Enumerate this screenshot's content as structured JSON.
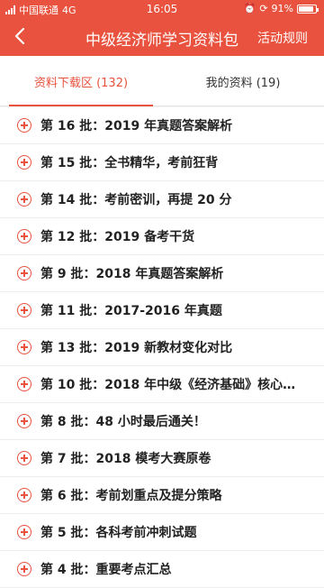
{
  "status": {
    "carrier": "中国联通",
    "network": "4G",
    "time": "16:05",
    "battery": "91%",
    "battery_level": 0.91
  },
  "nav": {
    "back_icon": "chevron-left-icon",
    "title": "中级经济师学习资料包",
    "action": "活动规则"
  },
  "tabs": [
    {
      "label": "资料下载区 (132)",
      "active": true
    },
    {
      "label": "我的资料 (19)",
      "active": false
    }
  ],
  "items": [
    {
      "label": "第 16 批：2019 年真题答案解析"
    },
    {
      "label": "第 15 批：全书精华，考前狂背"
    },
    {
      "label": "第 14 批：考前密训，再提 20 分"
    },
    {
      "label": "第 12 批：2019 备考干货"
    },
    {
      "label": "第 9 批：2018 年真题答案解析"
    },
    {
      "label": "第 11 批：2017-2016 年真题"
    },
    {
      "label": "第 13 批：2019 新教材变化对比"
    },
    {
      "label": "第 10 批：2018 年中级《经济基础》核心…"
    },
    {
      "label": "第 8 批：48 小时最后通关！"
    },
    {
      "label": "第 7 批：2018 模考大赛原卷"
    },
    {
      "label": "第 6 批：考前划重点及提分策略"
    },
    {
      "label": "第 5 批：各科考前冲刺试题"
    },
    {
      "label": "第 4 批：重要考点汇总"
    }
  ],
  "colors": {
    "accent": "#e8523e"
  }
}
